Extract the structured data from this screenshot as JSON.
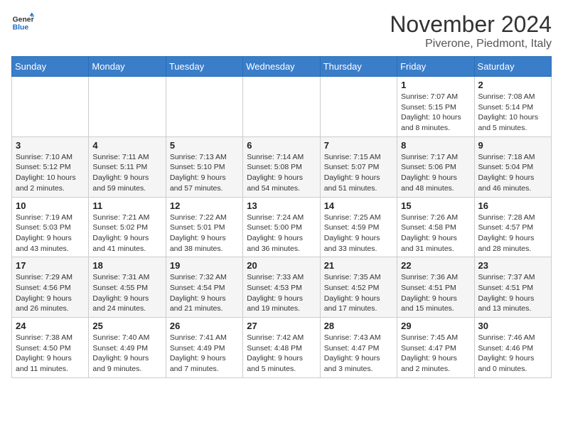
{
  "logo": {
    "general": "General",
    "blue": "Blue"
  },
  "header": {
    "month": "November 2024",
    "location": "Piverone, Piedmont, Italy"
  },
  "weekdays": [
    "Sunday",
    "Monday",
    "Tuesday",
    "Wednesday",
    "Thursday",
    "Friday",
    "Saturday"
  ],
  "weeks": [
    [
      {
        "day": "",
        "info": ""
      },
      {
        "day": "",
        "info": ""
      },
      {
        "day": "",
        "info": ""
      },
      {
        "day": "",
        "info": ""
      },
      {
        "day": "",
        "info": ""
      },
      {
        "day": "1",
        "info": "Sunrise: 7:07 AM\nSunset: 5:15 PM\nDaylight: 10 hours\nand 8 minutes."
      },
      {
        "day": "2",
        "info": "Sunrise: 7:08 AM\nSunset: 5:14 PM\nDaylight: 10 hours\nand 5 minutes."
      }
    ],
    [
      {
        "day": "3",
        "info": "Sunrise: 7:10 AM\nSunset: 5:12 PM\nDaylight: 10 hours\nand 2 minutes."
      },
      {
        "day": "4",
        "info": "Sunrise: 7:11 AM\nSunset: 5:11 PM\nDaylight: 9 hours\nand 59 minutes."
      },
      {
        "day": "5",
        "info": "Sunrise: 7:13 AM\nSunset: 5:10 PM\nDaylight: 9 hours\nand 57 minutes."
      },
      {
        "day": "6",
        "info": "Sunrise: 7:14 AM\nSunset: 5:08 PM\nDaylight: 9 hours\nand 54 minutes."
      },
      {
        "day": "7",
        "info": "Sunrise: 7:15 AM\nSunset: 5:07 PM\nDaylight: 9 hours\nand 51 minutes."
      },
      {
        "day": "8",
        "info": "Sunrise: 7:17 AM\nSunset: 5:06 PM\nDaylight: 9 hours\nand 48 minutes."
      },
      {
        "day": "9",
        "info": "Sunrise: 7:18 AM\nSunset: 5:04 PM\nDaylight: 9 hours\nand 46 minutes."
      }
    ],
    [
      {
        "day": "10",
        "info": "Sunrise: 7:19 AM\nSunset: 5:03 PM\nDaylight: 9 hours\nand 43 minutes."
      },
      {
        "day": "11",
        "info": "Sunrise: 7:21 AM\nSunset: 5:02 PM\nDaylight: 9 hours\nand 41 minutes."
      },
      {
        "day": "12",
        "info": "Sunrise: 7:22 AM\nSunset: 5:01 PM\nDaylight: 9 hours\nand 38 minutes."
      },
      {
        "day": "13",
        "info": "Sunrise: 7:24 AM\nSunset: 5:00 PM\nDaylight: 9 hours\nand 36 minutes."
      },
      {
        "day": "14",
        "info": "Sunrise: 7:25 AM\nSunset: 4:59 PM\nDaylight: 9 hours\nand 33 minutes."
      },
      {
        "day": "15",
        "info": "Sunrise: 7:26 AM\nSunset: 4:58 PM\nDaylight: 9 hours\nand 31 minutes."
      },
      {
        "day": "16",
        "info": "Sunrise: 7:28 AM\nSunset: 4:57 PM\nDaylight: 9 hours\nand 28 minutes."
      }
    ],
    [
      {
        "day": "17",
        "info": "Sunrise: 7:29 AM\nSunset: 4:56 PM\nDaylight: 9 hours\nand 26 minutes."
      },
      {
        "day": "18",
        "info": "Sunrise: 7:31 AM\nSunset: 4:55 PM\nDaylight: 9 hours\nand 24 minutes."
      },
      {
        "day": "19",
        "info": "Sunrise: 7:32 AM\nSunset: 4:54 PM\nDaylight: 9 hours\nand 21 minutes."
      },
      {
        "day": "20",
        "info": "Sunrise: 7:33 AM\nSunset: 4:53 PM\nDaylight: 9 hours\nand 19 minutes."
      },
      {
        "day": "21",
        "info": "Sunrise: 7:35 AM\nSunset: 4:52 PM\nDaylight: 9 hours\nand 17 minutes."
      },
      {
        "day": "22",
        "info": "Sunrise: 7:36 AM\nSunset: 4:51 PM\nDaylight: 9 hours\nand 15 minutes."
      },
      {
        "day": "23",
        "info": "Sunrise: 7:37 AM\nSunset: 4:51 PM\nDaylight: 9 hours\nand 13 minutes."
      }
    ],
    [
      {
        "day": "24",
        "info": "Sunrise: 7:38 AM\nSunset: 4:50 PM\nDaylight: 9 hours\nand 11 minutes."
      },
      {
        "day": "25",
        "info": "Sunrise: 7:40 AM\nSunset: 4:49 PM\nDaylight: 9 hours\nand 9 minutes."
      },
      {
        "day": "26",
        "info": "Sunrise: 7:41 AM\nSunset: 4:49 PM\nDaylight: 9 hours\nand 7 minutes."
      },
      {
        "day": "27",
        "info": "Sunrise: 7:42 AM\nSunset: 4:48 PM\nDaylight: 9 hours\nand 5 minutes."
      },
      {
        "day": "28",
        "info": "Sunrise: 7:43 AM\nSunset: 4:47 PM\nDaylight: 9 hours\nand 3 minutes."
      },
      {
        "day": "29",
        "info": "Sunrise: 7:45 AM\nSunset: 4:47 PM\nDaylight: 9 hours\nand 2 minutes."
      },
      {
        "day": "30",
        "info": "Sunrise: 7:46 AM\nSunset: 4:46 PM\nDaylight: 9 hours\nand 0 minutes."
      }
    ]
  ]
}
